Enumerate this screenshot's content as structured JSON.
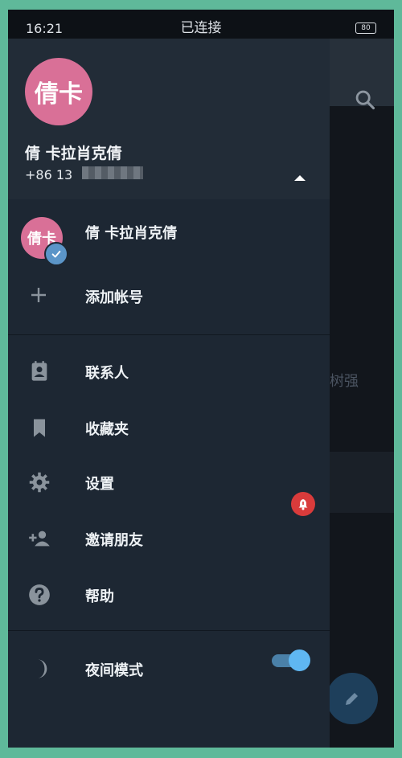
{
  "status_bar": {
    "time": "16:21",
    "connection": "已连接",
    "battery": "80"
  },
  "header": {
    "avatar_text": "倩卡",
    "name": "倩 卡拉肖克倩",
    "phone": "+86 13"
  },
  "accounts": [
    {
      "avatar_text": "倩卡",
      "label": "倩 卡拉肖克倩"
    }
  ],
  "add_account_label": "添加帐号",
  "menu_items": [
    {
      "label": "联系人",
      "icon": "contacts-icon"
    },
    {
      "label": "收藏夹",
      "icon": "bookmark-icon"
    },
    {
      "label": "设置",
      "icon": "gear-icon"
    },
    {
      "label": "邀请朋友",
      "icon": "add-person-icon"
    },
    {
      "label": "帮助",
      "icon": "help-icon"
    }
  ],
  "night_mode": {
    "label": "夜间模式",
    "icon": "moon-icon",
    "enabled": true
  },
  "background": {
    "chat_text": "树强"
  },
  "colors": {
    "accent": "#5fb7f2",
    "avatar": "#d97097",
    "alert": "#d93b3b",
    "drawer_bg": "#1d2733"
  }
}
